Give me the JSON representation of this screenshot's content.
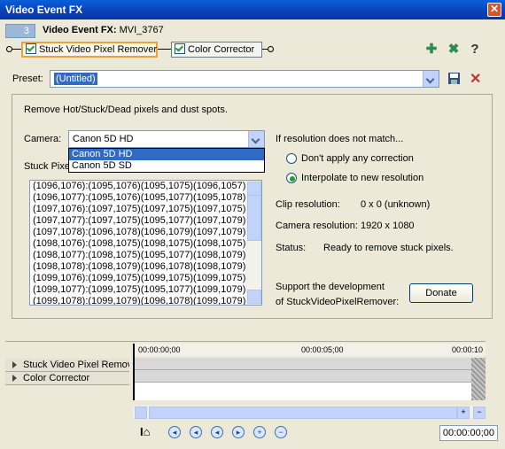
{
  "window": {
    "title": "Video Event FX"
  },
  "header": {
    "badge": "3",
    "label": "Video Event FX:",
    "clip": "MVI_3767"
  },
  "chain": {
    "plugins": [
      {
        "label": "Stuck Video Pixel Remover",
        "checked": true,
        "selected": true
      },
      {
        "label": "Color Corrector",
        "checked": true,
        "selected": false
      }
    ]
  },
  "toolbar": {
    "help": "?"
  },
  "preset": {
    "label": "Preset:",
    "value": "(Untitled)"
  },
  "panel": {
    "description": "Remove Hot/Stuck/Dead pixels and dust spots.",
    "camera_label": "Camera:",
    "camera_value": "Canon 5D HD",
    "camera_options": [
      "Canon 5D HD",
      "Canon 5D SD"
    ],
    "stuck_label": "Stuck Pixe",
    "pixels": [
      "(1096,1076):(1095,1076)(1095,1075)(1096,1057)",
      "(1096,1077):(1095,1076)(1095,1077)(1095,1078)",
      "(1097,1076):(1097,1075)(1097,1075)(1097,1075)",
      "(1097,1077):(1097,1075)(1095,1077)(1097,1079)",
      "(1097,1078):(1096,1078)(1096,1079)(1097,1079)",
      "(1098,1076):(1098,1075)(1098,1075)(1098,1075)",
      "(1098,1077):(1098,1075)(1095,1077)(1098,1079)",
      "(1098,1078):(1098,1079)(1096,1078)(1098,1079)",
      "(1099,1076):(1099,1075)(1099,1075)(1099,1075)",
      "(1099,1077):(1099,1075)(1095,1077)(1099,1079)",
      "(1099,1078):(1099,1079)(1096,1078)(1099,1079)"
    ],
    "resolution_heading": "If resolution does not match...",
    "option_no_correction": "Don't apply any correction",
    "option_interpolate": "Interpolate to new resolution",
    "selected_option": "interpolate",
    "clip_resolution_label": "Clip resolution:",
    "clip_resolution_value": "0 x 0 (unknown)",
    "camera_resolution_label": "Camera resolution:",
    "camera_resolution_value": "1920 x 1080",
    "status_label": "Status:",
    "status_value": "Ready to remove stuck pixels.",
    "support_line1": "Support the development",
    "support_line2": "of StuckVideoPixelRemover:",
    "donate_label": "Donate"
  },
  "timeline": {
    "tracks": [
      "Stuck Video Pixel Remov",
      "Color Corrector"
    ],
    "ruler": [
      "00:00:00;00",
      "00:00:05;00",
      "00:00:10"
    ],
    "current_time": "00:00:00;00"
  }
}
